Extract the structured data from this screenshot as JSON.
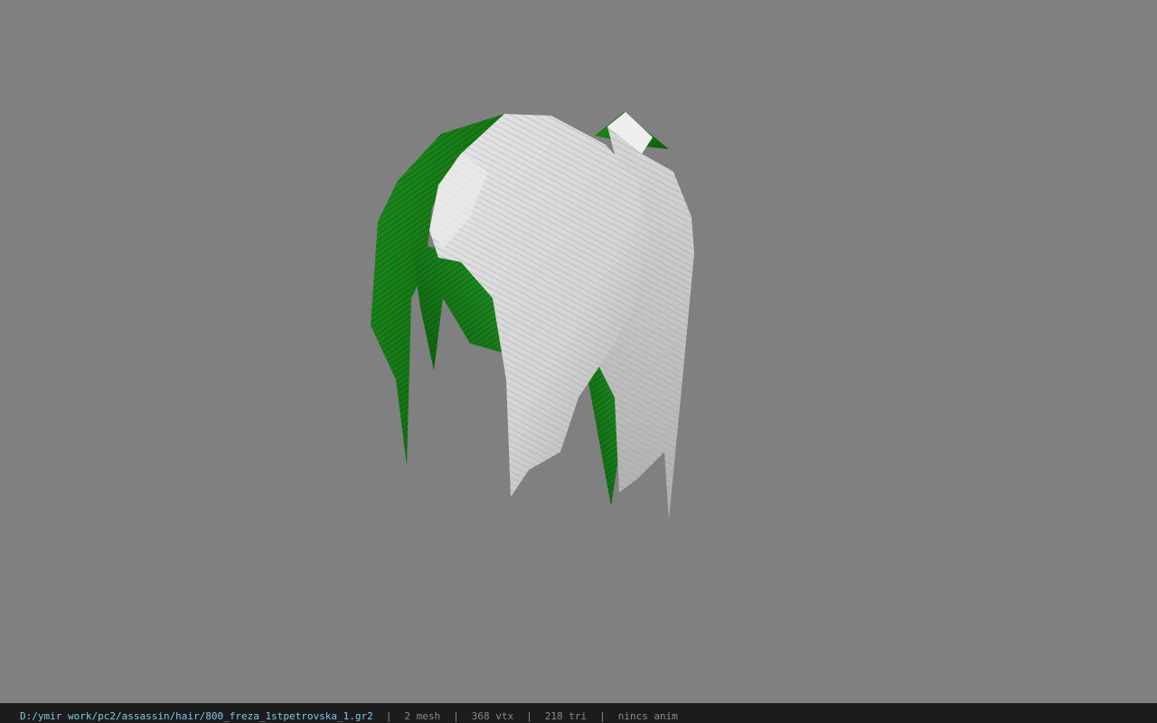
{
  "viewport": {
    "model_subject": "hair-mesh",
    "colors": {
      "background": "#808080",
      "hair_light": "#dcdcdc",
      "hair_dark": "#b9b9b9",
      "green_light": "#1f8f1f",
      "green_dark": "#0c5f0c"
    }
  },
  "status_bar": {
    "file_path": "D:/ymir work/pc2/assassin/hair/800_freza_1stpetrovska_1.gr2",
    "separator": "|",
    "mesh_count": "2 mesh",
    "vertex_count": "368 vtx",
    "triangle_count": "218 tri",
    "anim_status": "nincs anim"
  }
}
